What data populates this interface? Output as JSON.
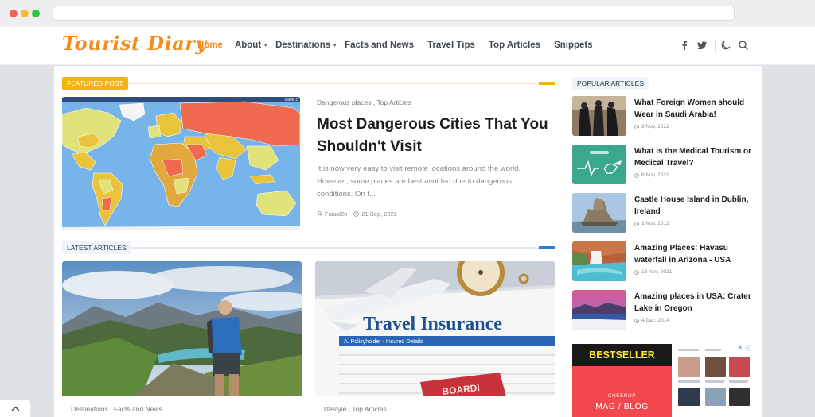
{
  "brand": {
    "logo_text": "Tourist Diary",
    "accent_color": "#f48b1e"
  },
  "nav": {
    "items": [
      {
        "label": "Home",
        "active": true
      },
      {
        "label": "About",
        "has_dropdown": true
      },
      {
        "label": "Destinations",
        "has_dropdown": true
      },
      {
        "label": "Facts and News"
      },
      {
        "label": "Travel Tips"
      },
      {
        "label": "Top Articles"
      },
      {
        "label": "Snippets"
      }
    ],
    "icons": [
      "facebook-icon",
      "twitter-icon",
      "moon-icon",
      "search-icon"
    ]
  },
  "featured": {
    "section_label": "FEATURED POST",
    "tags": "Dangerous places , Top Articles",
    "title": "Most Dangerous Cities That You Shouldn't Visit",
    "excerpt": "It is now very easy to visit remote locations around the world. However, some places are best avoided due to dangerous conditions. On t...",
    "author": "Faisal2n",
    "date": "21 Sep, 2022",
    "map_watermark": "Travel.S"
  },
  "latest": {
    "section_label": "LATEST ARTICLES",
    "cards": [
      {
        "tags": "Destinations , Facts and News"
      },
      {
        "tags": "lifestyle , Top Articles",
        "image_text": "Travel Insurance",
        "image_subtext": "A. Policyholder - Insured Details",
        "image_stamp": "BOARDI"
      }
    ]
  },
  "sidebar": {
    "section_label": "POPULAR ARTICLES",
    "items": [
      {
        "title": "What Foreign Women should Wear in Saudi Arabia!",
        "date": "9 Nov, 2021"
      },
      {
        "title": "What is the Medical Tourism or Medical Travel?",
        "date": "6 Nov, 2021"
      },
      {
        "title": "Castle House Island in Dublin, Ireland",
        "date": "1 Nov, 2012"
      },
      {
        "title": "Amazing Places: Havasu waterfall in Arizona - USA",
        "date": "16 Nov, 2021"
      },
      {
        "title": "Amazing places in USA: Crater Lake in Oregon",
        "date": "4 Dec, 2014"
      }
    ]
  },
  "ad": {
    "headline": "BESTSELLER",
    "brand": "CHEERUP",
    "tagline": "MAG / BLOG"
  }
}
